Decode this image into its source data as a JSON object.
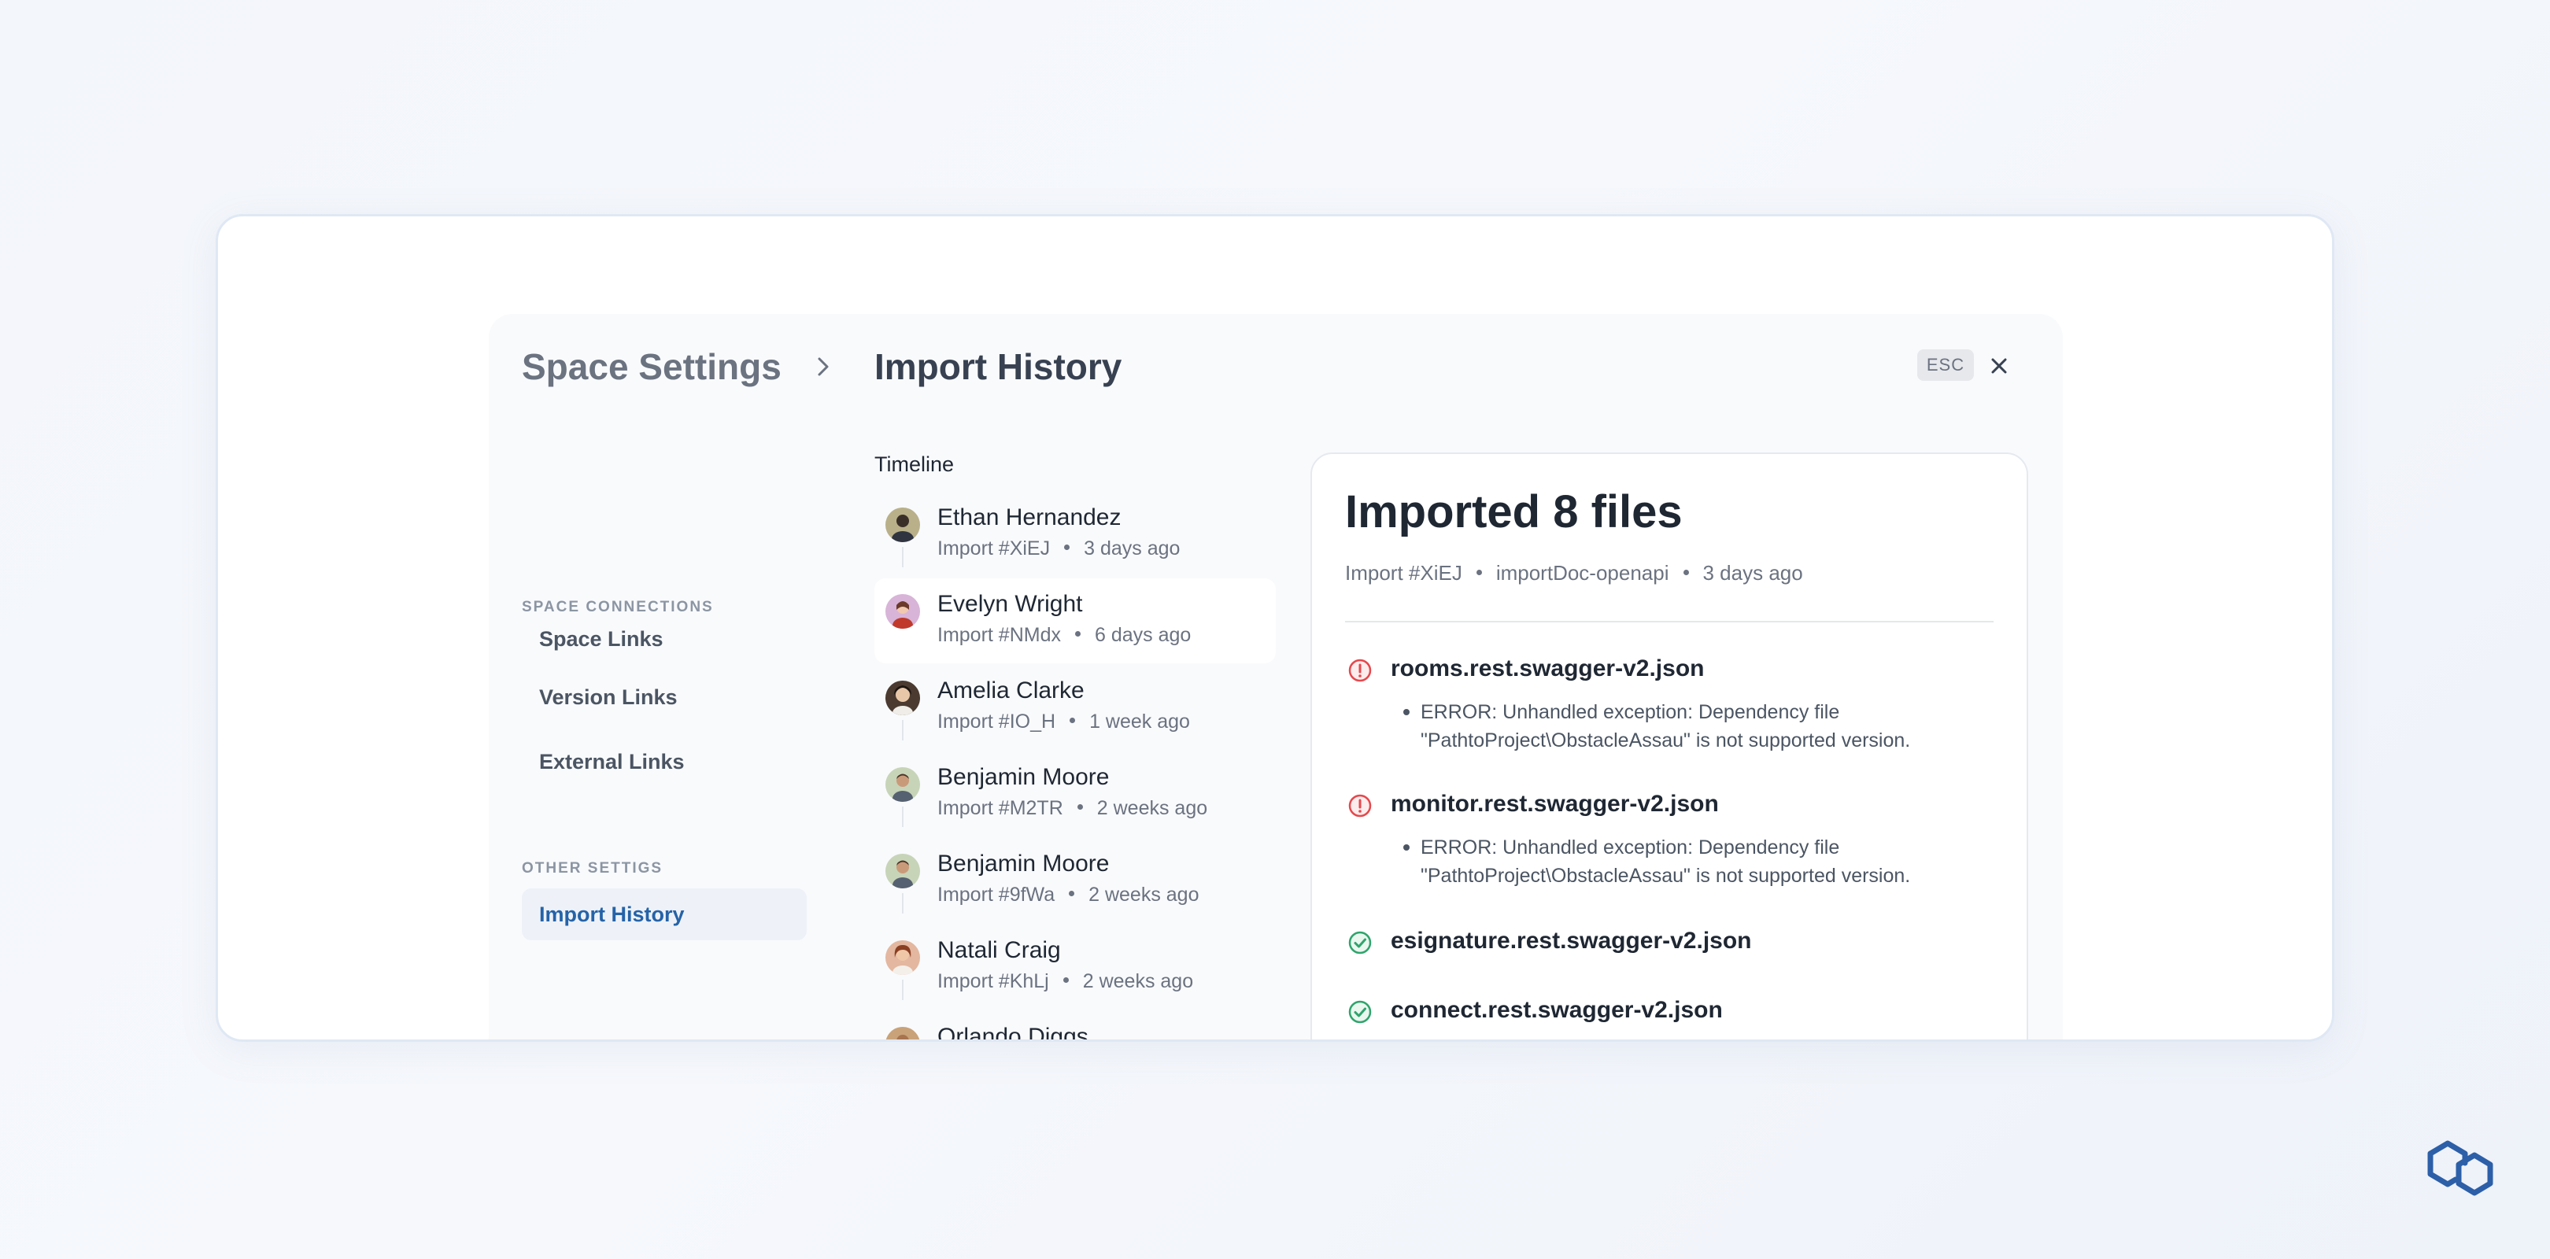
{
  "header": {
    "parent": "Space Settings",
    "title": "Import History",
    "esc_label": "ESC"
  },
  "sidebar": {
    "sections": [
      {
        "label": "SPACE CONNECTIONS",
        "items": [
          {
            "label": "Space Links"
          },
          {
            "label": "Version Links"
          },
          {
            "label": "External Links"
          }
        ]
      },
      {
        "label": "OTHER SETTIGS",
        "items": [
          {
            "label": "Import History",
            "active": true
          }
        ]
      }
    ]
  },
  "timeline": {
    "label": "Timeline",
    "items": [
      {
        "name": "Ethan Hernandez",
        "import_id": "Import #XiEJ",
        "time": "3 days ago",
        "avatar_color": "#b9b08a"
      },
      {
        "name": "Evelyn Wright",
        "import_id": "Import #NMdx",
        "time": "6 days ago",
        "avatar_color": "#d8b4d8",
        "selected": true
      },
      {
        "name": "Amelia Clarke",
        "import_id": "Import #IO_H",
        "time": "1 week ago",
        "avatar_color": "#4a3a30"
      },
      {
        "name": "Benjamin Moore",
        "import_id": "Import #M2TR",
        "time": "2 weeks ago",
        "avatar_color": "#c7d4b8"
      },
      {
        "name": "Benjamin Moore",
        "import_id": "Import #9fWa",
        "time": "2 weeks ago",
        "avatar_color": "#c7d4b8"
      },
      {
        "name": "Natali Craig",
        "import_id": "Import #KhLj",
        "time": "2 weeks ago",
        "avatar_color": "#e3b7a0"
      },
      {
        "name": "Orlando Diggs",
        "import_id": "",
        "time": "",
        "avatar_color": "#c9a27a"
      }
    ]
  },
  "detail": {
    "title": "Imported 8 files",
    "import_id": "Import #XiEJ",
    "source": "importDoc-openapi",
    "time": "3 days ago",
    "files": [
      {
        "name": "rooms.rest.swagger-v2.json",
        "status": "error",
        "message": "ERROR: Unhandled exception: Dependency file \"PathtoProject\\ObstacleAssau\" is not supported version."
      },
      {
        "name": "monitor.rest.swagger-v2.json",
        "status": "error",
        "message": "ERROR: Unhandled exception: Dependency file \"PathtoProject\\ObstacleAssau\" is not supported version."
      },
      {
        "name": "esignature.rest.swagger-v2.json",
        "status": "success"
      },
      {
        "name": "connect.rest.swagger-v2.json",
        "status": "success"
      }
    ]
  },
  "colors": {
    "accent": "#2563a8",
    "error": "#e5484d",
    "success": "#30a46c"
  }
}
